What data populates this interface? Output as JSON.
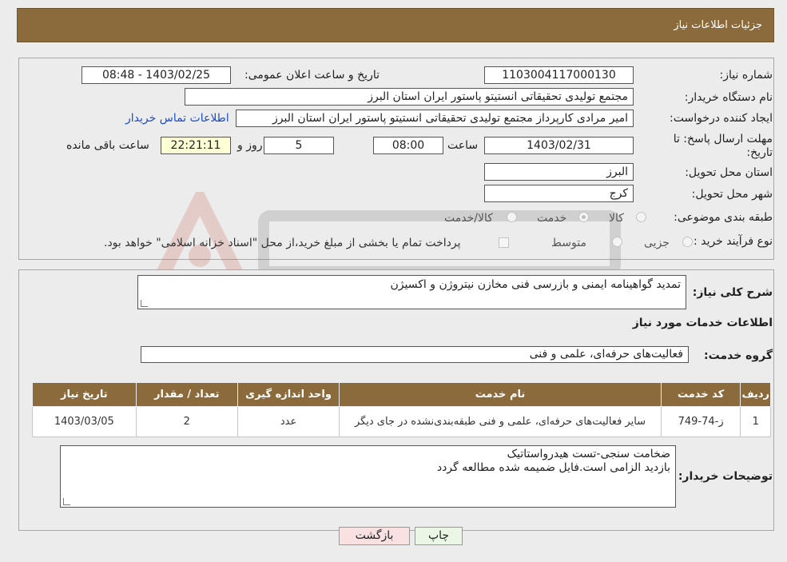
{
  "header": {
    "title": "جزئیات اطلاعات نیاز"
  },
  "form": {
    "need_number_label": "شماره نیاز:",
    "need_number": "1103004117000130",
    "announce_label": "تاریخ و ساعت اعلان عمومی:",
    "announce_value": "1403/02/25 - 08:48",
    "buyer_org_label": "نام دستگاه خریدار:",
    "buyer_org": "مجتمع تولیدی تحقیقاتی انستیتو پاستور ایران استان البرز",
    "creator_label": "ایجاد کننده درخواست:",
    "creator": "امیر مرادی کارپرداز مجتمع تولیدی تحقیقاتی انستیتو پاستور ایران استان البرز",
    "contact_link": "اطلاعات تماس خریدار",
    "deadline_label_1": "مهلت ارسال پاسخ: تا",
    "deadline_label_2": "تاریخ:",
    "deadline_date": "1403/02/31",
    "time_label": "ساعت",
    "deadline_time": "08:00",
    "days_value": "5",
    "days_label": "روز و",
    "remaining_time": "22:21:11",
    "remaining_label": "ساعت باقی مانده",
    "province_label": "استان محل تحویل:",
    "province": "البرز",
    "city_label": "شهر محل تحویل:",
    "city": "کرج",
    "category_label": "طبقه بندی موضوعی:",
    "category_options": [
      "کالا",
      "خدمت",
      "کالا/خدمت"
    ],
    "process_label": "نوع فرآیند خرید :",
    "process_options": [
      "جزیی",
      "متوسط"
    ],
    "payment_note": "پرداخت تمام یا بخشی از مبلغ خرید،از محل \"اسناد خزانه اسلامی\" خواهد بود."
  },
  "summary": {
    "label": "شرح کلی نیاز:",
    "value": "تمدید گواهینامه ایمنی و بازرسی فنی مخازن نیتروژن و اکسیژن"
  },
  "services": {
    "section_title": "اطلاعات خدمات مورد نیاز",
    "group_label": "گروه خدمت:",
    "group_value": "فعالیت‌های حرفه‌ای، علمی و فنی",
    "columns": [
      "ردیف",
      "کد خدمت",
      "نام خدمت",
      "واحد اندازه گیری",
      "تعداد / مقدار",
      "تاریخ نیاز"
    ],
    "rows": [
      [
        "1",
        "ز-74-749",
        "سایر فعالیت‌های حرفه‌ای، علمی و فنی طبقه‌بندی‌نشده در جای دیگر",
        "عدد",
        "2",
        "1403/03/05"
      ]
    ]
  },
  "buyer_notes": {
    "label": "توضیحات خریدار:",
    "line1": "ضخامت سنجی-تست هیدرواستاتیک",
    "line2": "بازدید الزامی است.فایل ضمیمه شده مطالعه گردد"
  },
  "buttons": {
    "print": "چاپ",
    "back": "بازگشت"
  },
  "colors": {
    "header": "#8b6a3c",
    "print_bg": "#eaf7e6",
    "back_bg": "#f9e1e1",
    "link": "#1a4dcc"
  }
}
